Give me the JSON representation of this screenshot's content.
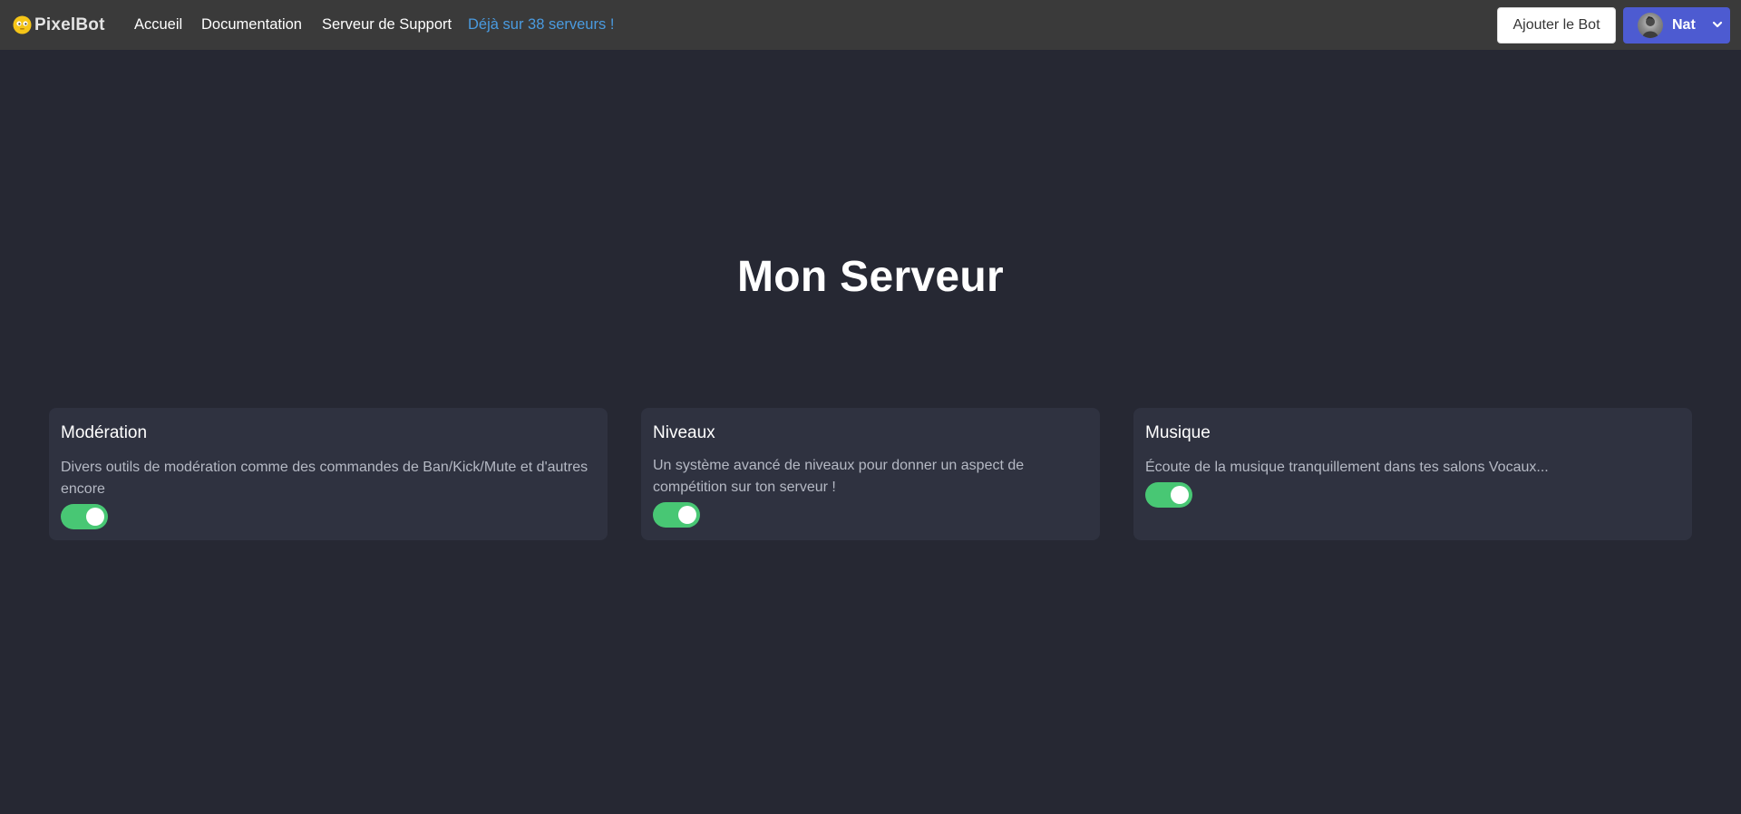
{
  "navbar": {
    "brand": "PixelBot",
    "links": {
      "home": "Accueil",
      "docs": "Documentation",
      "support": "Serveur de Support",
      "servers": "Déjà sur 38 serveurs !"
    },
    "add_bot_label": "Ajouter le Bot",
    "user_name": "Nat"
  },
  "main": {
    "title": "Mon Serveur",
    "modules": [
      {
        "title": "Modération",
        "description": "Divers outils de modération comme des commandes de Ban/Kick/Mute et d'autres encore",
        "enabled": true
      },
      {
        "title": "Niveaux",
        "description": "Un système avancé de niveaux pour donner un aspect de compétition sur ton serveur !",
        "enabled": true
      },
      {
        "title": "Musique",
        "description": "Écoute de la musique tranquillement dans tes salons Vocaux...",
        "enabled": true
      }
    ]
  },
  "colors": {
    "page_bg": "#262833",
    "navbar_bg": "#3a3a3a",
    "card_bg": "#2f3240",
    "accent_link": "#4a9be0",
    "user_button": "#4d5bd1",
    "toggle_on": "#48c774",
    "brand_icon": "#f5c518"
  },
  "icons": {
    "brand": "pixelbot-face-icon",
    "avatar": "user-avatar",
    "dropdown": "chevron-down-icon"
  }
}
